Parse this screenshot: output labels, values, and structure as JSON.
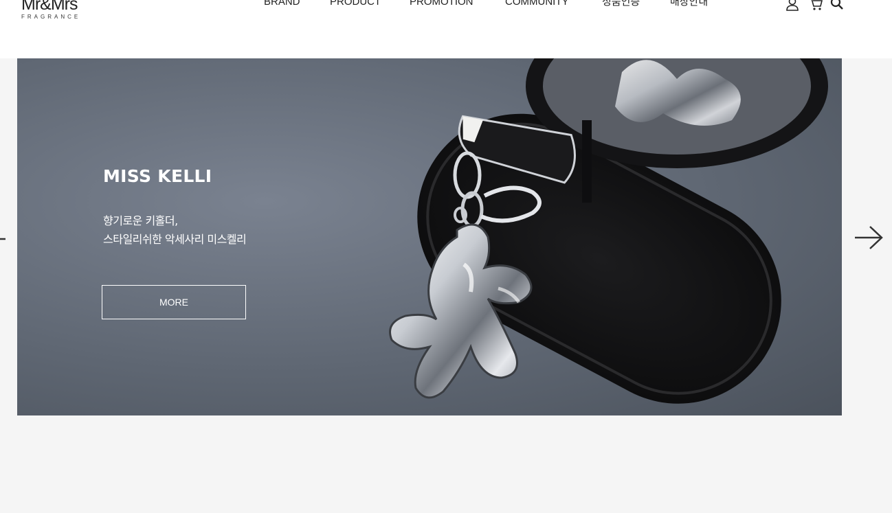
{
  "header": {
    "logo_main": "Mr&Mrs",
    "logo_sub": "FRAGRANCE",
    "nav": [
      {
        "label": "BRAND"
      },
      {
        "label": "PRODUCT"
      },
      {
        "label": "PROMOTION"
      },
      {
        "label": "COMMUNITY"
      },
      {
        "label": "정품인증"
      },
      {
        "label": "매장안내"
      }
    ],
    "icons": [
      "user-icon",
      "cart-icon",
      "search-icon"
    ]
  },
  "hero": {
    "title": "MISS KELLI",
    "line1": "향기로운 키홀더,",
    "line2": "스타일리쉬한 악세사리 미스켈리",
    "button_label": "MORE"
  },
  "carousel": {
    "prev_icon": "arrow-left-icon",
    "next_icon": "arrow-right-icon"
  },
  "colors": {
    "page_bg": "#f5f5f5",
    "header_bg": "#ffffff",
    "hero_bg": "#5f6773",
    "text_light": "#ffffff",
    "text_dark": "#222222"
  }
}
